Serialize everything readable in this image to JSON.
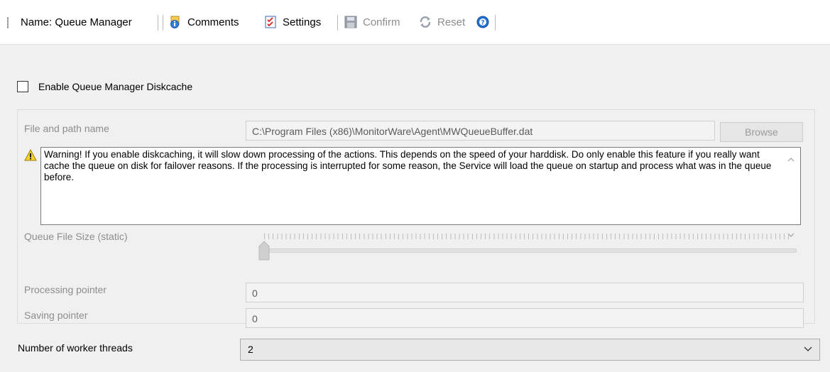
{
  "toolbar": {
    "name_label": "Name: Queue Manager",
    "comments_label": "Comments",
    "settings_label": "Settings",
    "confirm_label": "Confirm",
    "reset_label": "Reset"
  },
  "diskcache": {
    "enable_label": "Enable Queue Manager Diskcache",
    "enabled": false
  },
  "file": {
    "label": "File and path name",
    "value": "C:\\Program Files (x86)\\MonitorWare\\Agent\\MWQueueBuffer.dat",
    "browse_label": "Browse"
  },
  "warning": {
    "text": "Warning! If you enable diskcaching, it will slow down processing of the actions. This depends on the speed of your harddisk. Do only enable this feature if you really want cache the queue on disk for failover reasons. If the processing is interrupted for some reason, the Service will load the queue on startup and process what was in the queue before."
  },
  "queue_size": {
    "label": "Queue File Size (static)",
    "level": 0
  },
  "pointers": {
    "processing_label": "Processing pointer",
    "processing_value": "0",
    "saving_label": "Saving pointer",
    "saving_value": "0"
  },
  "workers": {
    "label": "Number of worker threads",
    "value": "2"
  },
  "colors": {
    "disabled_text": "#8d8d8d",
    "warning_yellow": "#f5d327",
    "help_blue": "#1f6fd6"
  }
}
